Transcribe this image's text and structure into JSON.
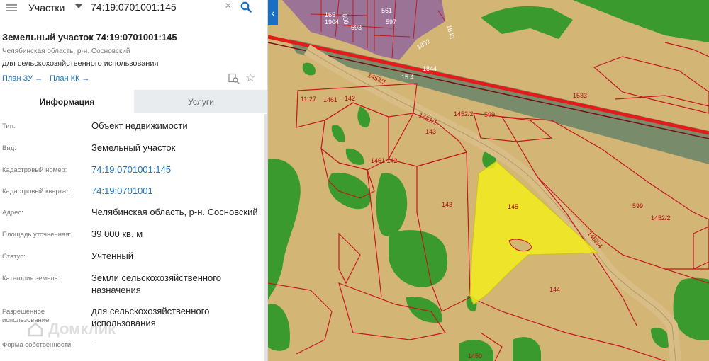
{
  "search": {
    "layer": "Участки",
    "query": "74:19:0701001:145"
  },
  "parcel": {
    "title": "Земельный участок 74:19:0701001:145",
    "address_short": "Челябинская область, р-н. Сосновский",
    "usage_short": "для сельскохозяйственного использования",
    "links": {
      "plan_zu": "План ЗУ",
      "plan_kk": "План КК"
    }
  },
  "tabs": [
    {
      "label": "Информация",
      "active": true
    },
    {
      "label": "Услуги",
      "active": false
    }
  ],
  "properties": [
    {
      "label": "Тип:",
      "value": "Объект недвижимости",
      "link": false
    },
    {
      "label": "Вид:",
      "value": "Земельный участок",
      "link": false
    },
    {
      "label": "Кадастровый номер:",
      "value": "74:19:0701001:145",
      "link": true
    },
    {
      "label": "Кадастровый квартал:",
      "value": "74:19:0701001",
      "link": true
    },
    {
      "label": "Адрес:",
      "value": "Челябинская область, р-н. Сосновский",
      "link": false
    },
    {
      "label": "Площадь уточненная:",
      "value": "39 000 кв. м",
      "link": false
    },
    {
      "label": "Статус:",
      "value": "Учтенный",
      "link": false
    },
    {
      "label": "Категория земель:",
      "value": "Земли сельскохозяйственного назначения",
      "link": false
    },
    {
      "label": "Разрешенное использование:",
      "value": "для сельскохозяйственного использования",
      "link": false
    },
    {
      "label": "Форма собственности:",
      "value": "-",
      "link": false
    }
  ],
  "watermark": "Домклик",
  "map": {
    "selected_parcel": "145",
    "labels": [
      "165",
      "1904",
      "600",
      "593",
      "561",
      "597",
      "1843",
      "1832",
      "1844",
      "15.4",
      "1452/1",
      "1533",
      "11.27",
      "1461",
      "142",
      "1451/1",
      "1452/2",
      "599",
      "143",
      "1461 142",
      "143",
      "145",
      "1452/4",
      "599",
      "1452/2",
      "144",
      "1450"
    ],
    "colors": {
      "ground": "#d3b576",
      "forest": "#3a9a2e",
      "road": "#d2b07a",
      "railway": "#e31b1b",
      "urban": "#9b7396",
      "selected": "#f2ec1c",
      "boundary": "#c4181b",
      "water_strip": "#5a7f6a",
      "accent": "#1a6fc4"
    }
  }
}
